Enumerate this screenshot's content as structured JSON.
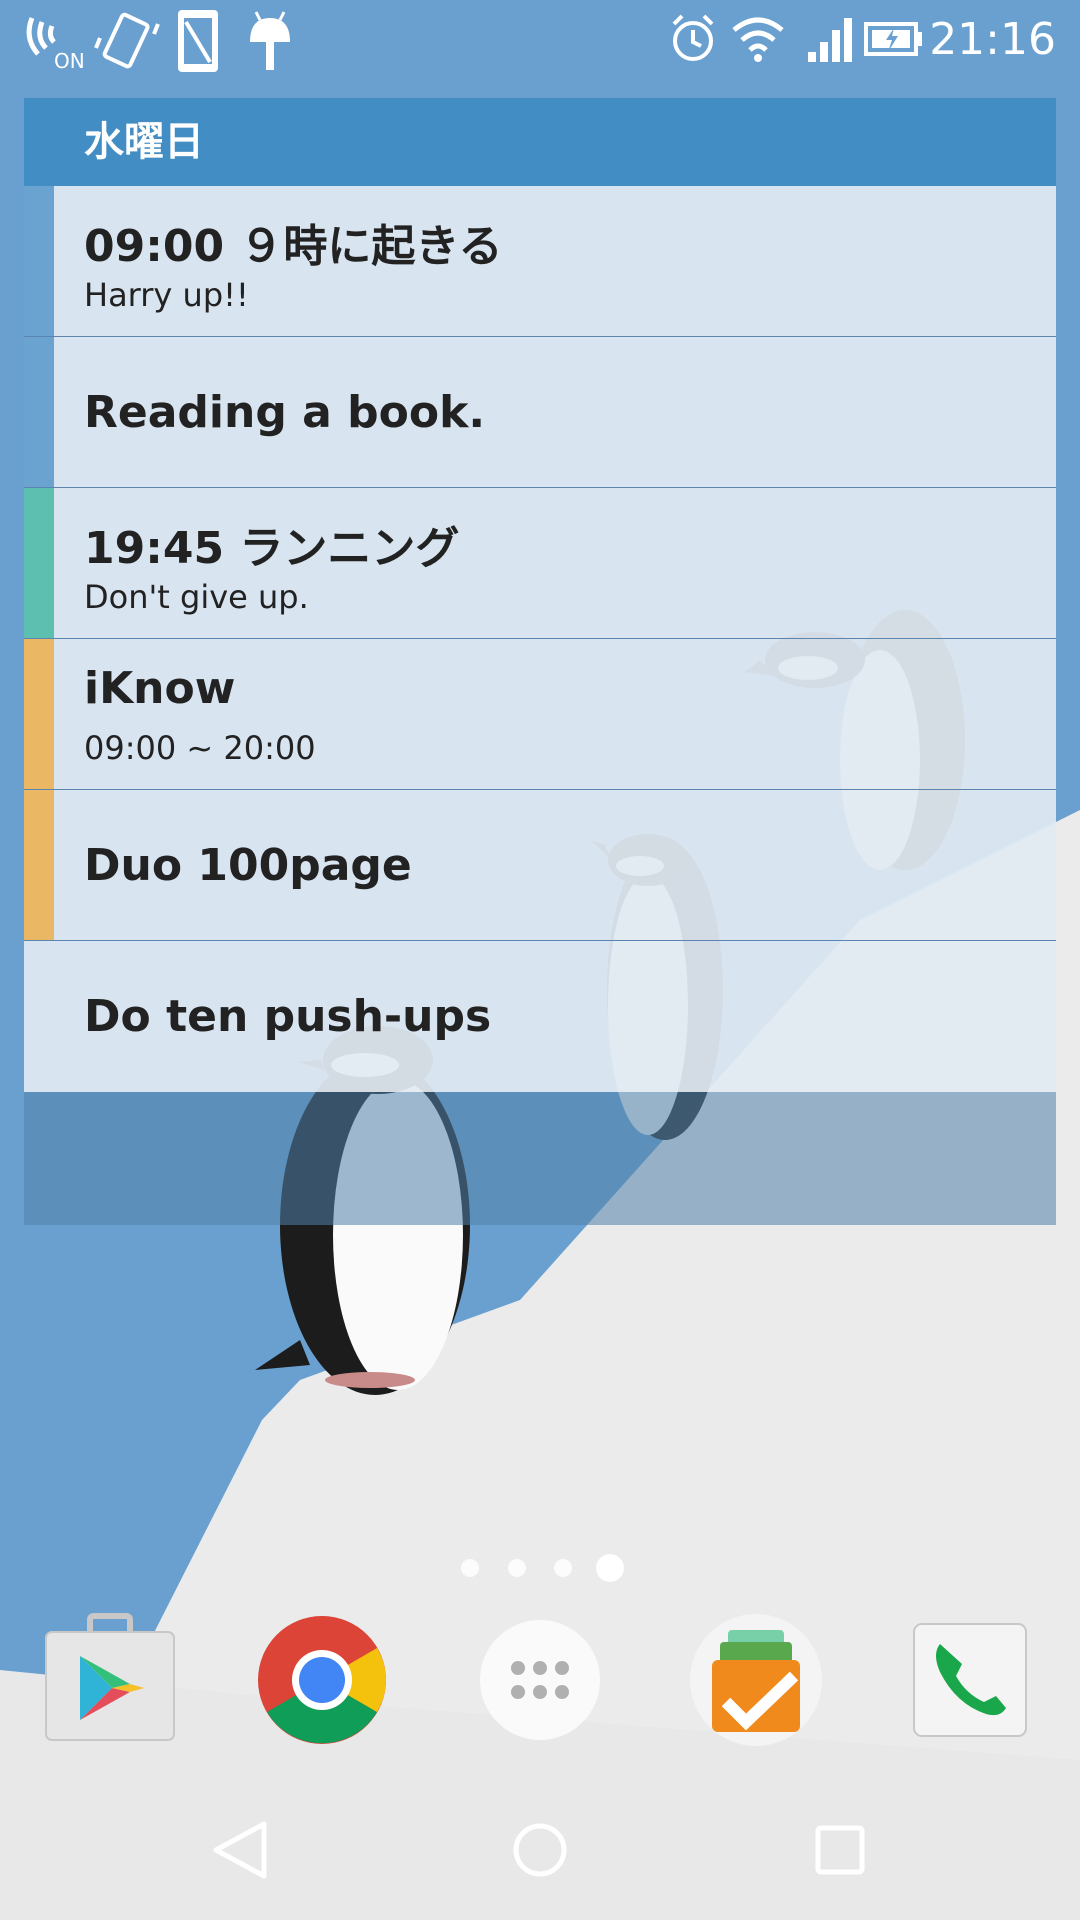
{
  "status_bar": {
    "time": "21:16",
    "left_icons": [
      "nfc-on-icon",
      "vibrate-icon",
      "screen-rotation-icon",
      "android-debug-icon"
    ],
    "right_icons": [
      "alarm-icon",
      "wifi-icon",
      "signal-icon",
      "battery-charging-icon"
    ],
    "nfc_label": "ON"
  },
  "widget": {
    "day_label": "水曜日",
    "events": [
      {
        "title": "09:00 ９時に起きる",
        "subtitle": "Harry up!!",
        "color": "#6aa3cf"
      },
      {
        "title": "Reading a book.",
        "subtitle": "",
        "color": "#6aa3cf"
      },
      {
        "title": "19:45 ランニング",
        "subtitle": "Don't give up.",
        "color": "#5dbfb0"
      },
      {
        "title": "iKnow",
        "subtitle": "09:00 ~ 20:00",
        "color": "#eab865"
      },
      {
        "title": "Duo 100page",
        "subtitle": "",
        "color": "#eab865"
      },
      {
        "title": "Do ten push-ups",
        "subtitle": "",
        "color": ""
      }
    ]
  },
  "home": {
    "page_count": 4,
    "active_page": 4
  },
  "dock": {
    "apps": [
      "play-store-icon",
      "chrome-icon",
      "app-drawer-icon",
      "task-app-icon",
      "phone-icon"
    ]
  },
  "nav_bar": {
    "buttons": [
      "back-icon",
      "home-icon",
      "recents-icon"
    ]
  },
  "colors": {
    "sky": "#6aa0cf",
    "header": "#428dc3",
    "snow": "#ebebeb"
  }
}
